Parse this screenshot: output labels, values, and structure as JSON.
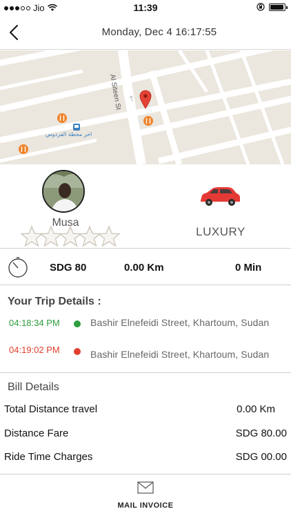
{
  "status_bar": {
    "carrier": "Jio",
    "time": "11:39"
  },
  "nav": {
    "title": "Monday, Dec 4  16:17:55"
  },
  "map": {
    "street_label": "Al Siteen St",
    "poi_label": "اخر محطة الفردوس"
  },
  "driver": {
    "name": "Musa",
    "rating": 0,
    "max_rating": 5
  },
  "car": {
    "type": "LUXURY",
    "color": "#e53935"
  },
  "stats": {
    "fare": "SDG 80",
    "distance": "0.00 Km",
    "duration": "0 Min"
  },
  "trip": {
    "title": "Your Trip Details :",
    "items": [
      {
        "time": "04:18:34 PM",
        "address": "Bashir Elnefeidi Street, Khartoum, Sudan",
        "color": "#2e9e3e"
      },
      {
        "time": "04:19:02 PM",
        "address": "Bashir Elnefeidi Street, Khartoum, Sudan",
        "color": "#e0402e"
      }
    ]
  },
  "bill": {
    "title": "Bill Details",
    "rows": [
      {
        "label": "Total Distance travel",
        "value": "0.00 Km"
      },
      {
        "label": "Distance Fare",
        "value": "SDG 80.00"
      },
      {
        "label": "Ride Time Charges",
        "value": "SDG 00.00"
      }
    ]
  },
  "footer": {
    "mail_label": "MAIL INVOICE"
  }
}
